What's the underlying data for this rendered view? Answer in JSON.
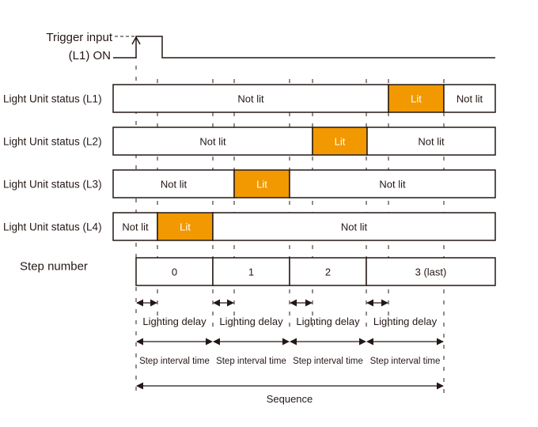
{
  "trigger": {
    "label_line1": "Trigger input",
    "label_line2": "(L1) ON"
  },
  "colors": {
    "lit": "#F29800",
    "line": "#231815",
    "lit_text": "#ffffff",
    "text": "#231815"
  },
  "rows": [
    {
      "label": "Light Unit status (L1)",
      "segments": [
        {
          "text": "Not lit",
          "state": "off"
        },
        {
          "text": "Lit",
          "state": "on"
        },
        {
          "text": "Not lit",
          "state": "off"
        }
      ]
    },
    {
      "label": "Light Unit status (L2)",
      "segments": [
        {
          "text": "Not lit",
          "state": "off"
        },
        {
          "text": "Lit",
          "state": "on"
        },
        {
          "text": "Not lit",
          "state": "off"
        }
      ]
    },
    {
      "label": "Light Unit status (L3)",
      "segments": [
        {
          "text": "Not lit",
          "state": "off"
        },
        {
          "text": "Lit",
          "state": "on"
        },
        {
          "text": "Not lit",
          "state": "off"
        }
      ]
    },
    {
      "label": "Light Unit status (L4)",
      "segments": [
        {
          "text": "Not lit",
          "state": "off"
        },
        {
          "text": "Lit",
          "state": "on"
        },
        {
          "text": "Not lit",
          "state": "off"
        }
      ]
    }
  ],
  "steps": {
    "label": "Step number",
    "items": [
      "0",
      "1",
      "2",
      "3 (last)"
    ]
  },
  "annotations": {
    "lighting_delay": "Lighting delay",
    "step_interval": "Step interval time",
    "sequence": "Sequence"
  }
}
